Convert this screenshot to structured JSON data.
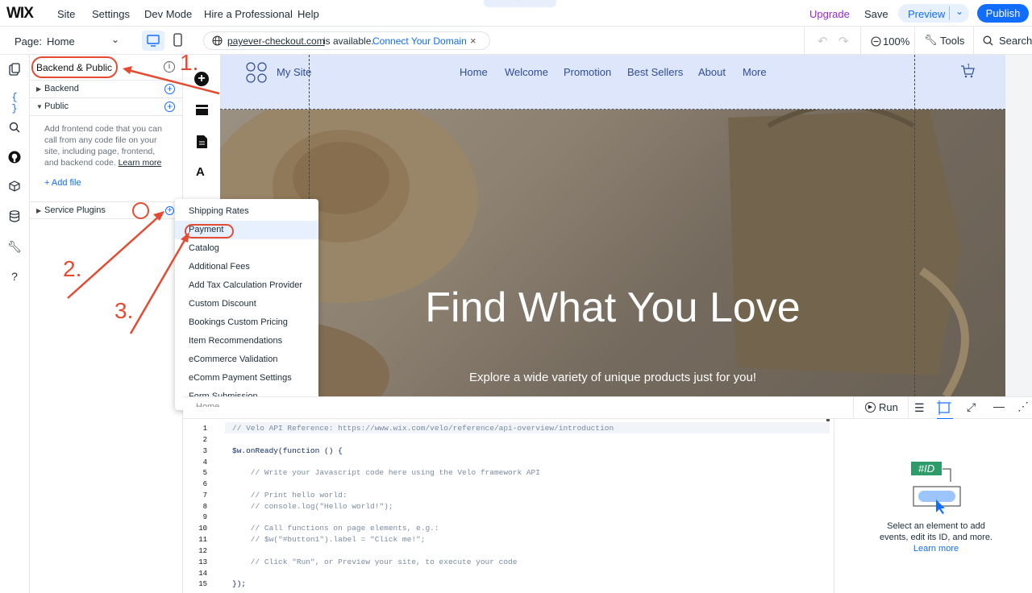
{
  "topbar": {
    "logo": "WIX",
    "menu": [
      "Site",
      "Settings",
      "Dev Mode",
      "Hire a Professional",
      "Help"
    ],
    "upgrade": "Upgrade",
    "save": "Save",
    "preview": "Preview",
    "publish": "Publish"
  },
  "secondbar": {
    "page_label": "Page:",
    "page_value": "Home",
    "url": "payever-checkout.com",
    "url_status": "is available.",
    "connect": "Connect Your Domain",
    "zoom": "100%",
    "tools": "Tools",
    "search": "Search"
  },
  "codepanel": {
    "title": "Backend & Public",
    "backend": "Backend",
    "public": "Public",
    "public_desc": "Add frontend code that you can call from any code file on your site, including page, frontend, and backend code.",
    "learn_more": "Learn more",
    "add_file": "+ Add file",
    "service_plugins": "Service Plugins"
  },
  "menu": {
    "items": [
      "Shipping Rates",
      "Payment",
      "Catalog",
      "Additional Fees",
      "Add Tax Calculation Provider",
      "Custom Discount",
      "Bookings Custom Pricing",
      "Item Recommendations",
      "eCommerce Validation",
      "eComm Payment Settings",
      "Form Submission"
    ]
  },
  "site": {
    "logo_text": "My Site",
    "nav": [
      "Home",
      "Welcome",
      "Promotion",
      "Best Sellers",
      "About",
      "More"
    ],
    "cart_count": "1",
    "hero_title": "Find What You Love",
    "hero_sub": "Explore a wide variety of unique products just for you!"
  },
  "editor": {
    "run": "Run",
    "tab_fragment": "Home",
    "lines": [
      {
        "n": "1",
        "t": "// Velo API Reference: https://www.wix.com/velo/reference/api-overview/introduction"
      },
      {
        "n": "2",
        "t": ""
      },
      {
        "n": "3",
        "t": "$w.onReady(function () {"
      },
      {
        "n": "4",
        "t": ""
      },
      {
        "n": "5",
        "t": "    // Write your Javascript code here using the Velo framework API"
      },
      {
        "n": "6",
        "t": ""
      },
      {
        "n": "7",
        "t": "    // Print hello world:"
      },
      {
        "n": "8",
        "t": "    // console.log(\"Hello world!\");"
      },
      {
        "n": "9",
        "t": ""
      },
      {
        "n": "10",
        "t": "    // Call functions on page elements, e.g.:"
      },
      {
        "n": "11",
        "t": "    // $w(\"#button1\").label = \"Click me!\";"
      },
      {
        "n": "12",
        "t": ""
      },
      {
        "n": "13",
        "t": "    // Click \"Run\", or Preview your site, to execute your code"
      },
      {
        "n": "14",
        "t": ""
      },
      {
        "n": "15",
        "t": "});"
      }
    ]
  },
  "sidepanel": {
    "id_label": "#ID",
    "text": "Select an element to add events, edit its ID, and more.",
    "learn_more": "Learn more"
  },
  "annotations": [
    "1.",
    "2.",
    "3."
  ],
  "colors": {
    "accent": "#116dff",
    "annotation": "#e44b32",
    "upgrade": "#9a27d5"
  }
}
